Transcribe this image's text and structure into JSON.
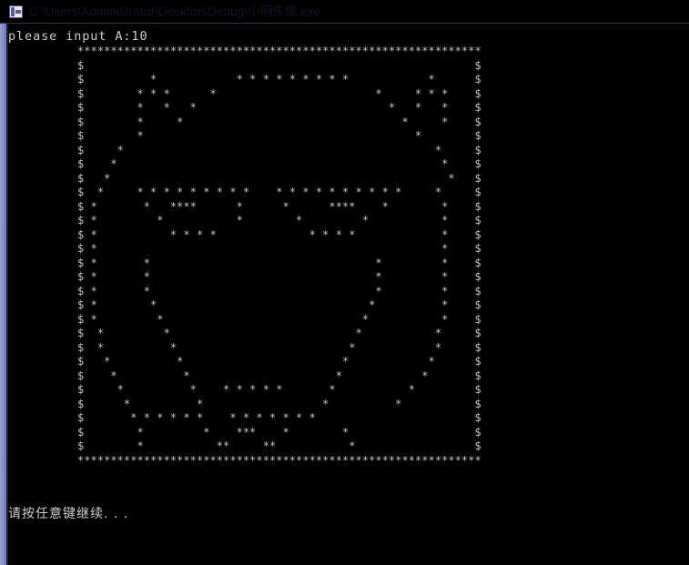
{
  "window": {
    "title": "C:\\Users\\Administrator\\Desktop\\Debug\\小明头像.exe",
    "icon": "console-app-icon",
    "frame_color": "#8a8fc9",
    "titlebar_color": "#565da6",
    "client_background": "#000000",
    "client_foreground": "#c0c0c0"
  },
  "console": {
    "prompt_line": "please input A:10",
    "pause_line": "请按任意键继续. . .",
    "border_char": "*",
    "side_char": "$",
    "fill_char": "*",
    "grid_columns": 61,
    "grid_rows": 30,
    "art_title": "smiley face ascii art",
    "art_rows": [
      "*************************************************************",
      "$                                                           $",
      "$          *            * * * * * * * * *            *      $",
      "$        * * *      *                        *     * * *    $",
      "$        *   *   *                             *   *   *    $",
      "$        *     *                                 *     *    $",
      "$        *                                         *        $",
      "$     *                                               *     $",
      "$    *                                                 *    $",
      "$   *                                                   *   $",
      "$  *     * * * * * * * * *    * * * * * * * * * *     *     $",
      "$ *       *   ****      *      *      ****    *        *    $",
      "$ *         *           *        *         *           *    $",
      "$ *           * * * *              * * * *             *    $",
      "$ *                                                    *    $",
      "$ *       *                                  *         *    $",
      "$ *       *                                  *         *    $",
      "$ *       *                                  *         *    $",
      "$ *        *                                *          *    $",
      "$ *         *                              *           *    $",
      "$  *         *                            *           *     $",
      "$  *          *                          *            *     $",
      "$   *          *                        *            *      $",
      "$    *          *                      *            *       $",
      "$     *          *    * * * * *       *           *         $",
      "$      *          *                  *          *           $",
      "$       * * * * * *    * * * * * * *                        $",
      "$        *         *    ***    *        *                   $",
      "$        *           **     **           *                  $",
      "*************************************************************"
    ]
  }
}
